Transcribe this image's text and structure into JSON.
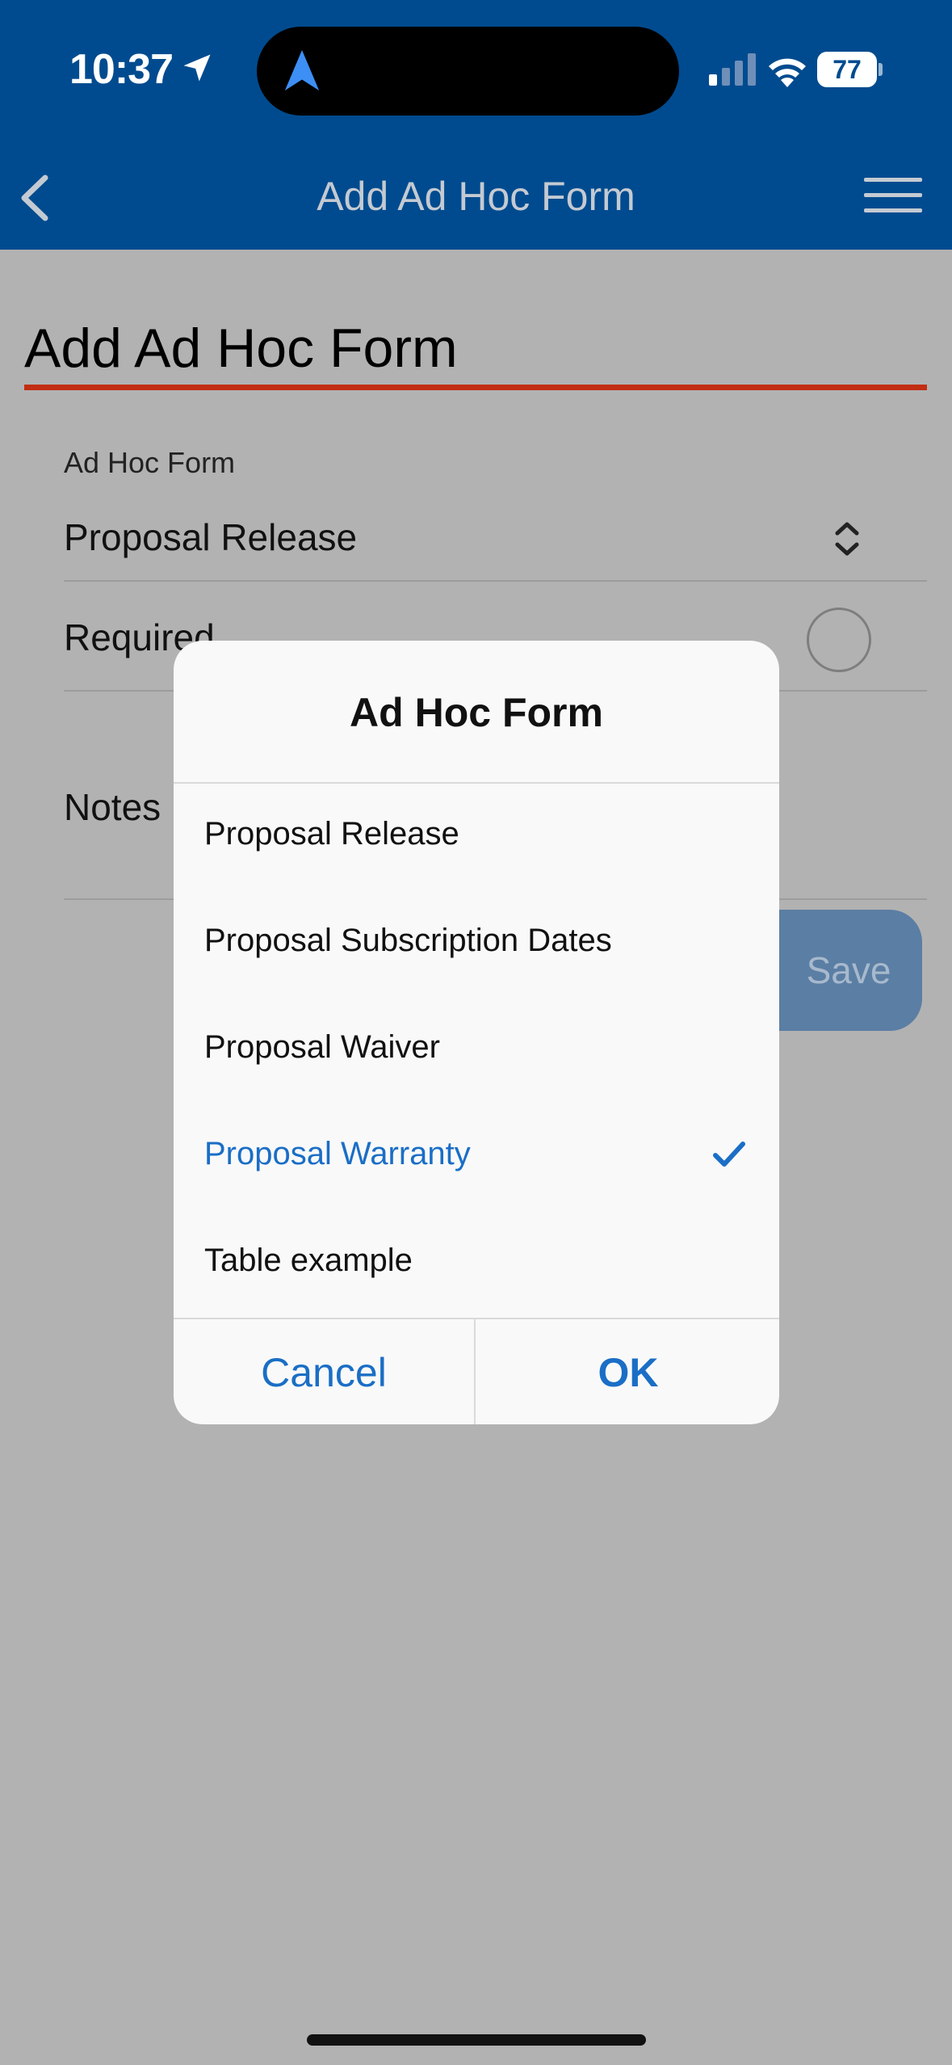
{
  "status_bar": {
    "time": "10:37",
    "battery": "77",
    "icons": [
      "location-arrow-icon",
      "navigation-icon",
      "cellular-signal-icon",
      "wifi-icon",
      "battery-icon"
    ]
  },
  "nav": {
    "title": "Add Ad Hoc Form",
    "back_icon": "chevron-left-icon",
    "menu_icon": "hamburger-menu-icon"
  },
  "form": {
    "page_title": "Add Ad Hoc Form",
    "ad_hoc_label": "Ad Hoc Form",
    "ad_hoc_value": "Proposal Release",
    "required_label": "Required",
    "notes_label": "Notes",
    "save_label": "Save"
  },
  "dialog": {
    "title": "Ad Hoc Form",
    "options": [
      {
        "label": "Proposal Release",
        "selected": false
      },
      {
        "label": "Proposal Subscription Dates",
        "selected": false
      },
      {
        "label": "Proposal Waiver",
        "selected": false
      },
      {
        "label": "Proposal Warranty",
        "selected": true
      },
      {
        "label": "Table example",
        "selected": false
      }
    ],
    "cancel_label": "Cancel",
    "ok_label": "OK"
  },
  "colors": {
    "header": "#004b8f",
    "accent": "#1a6ec6",
    "title_rule": "#c22e13",
    "overlay": "#b2b2b2"
  }
}
